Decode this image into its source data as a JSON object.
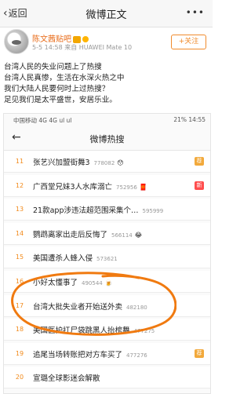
{
  "header": {
    "back_label": "返回",
    "title": "微博正文",
    "more": "•••"
  },
  "author": {
    "name": "陈文茜贴吧",
    "meta": "5-5 14:58 来自 HUAWEI Mate 10",
    "follow_label": "+关注"
  },
  "post_lines": [
    "台湾人民的失业问题上了热搜",
    "台湾人民真惨，生活在水深火热之中",
    "我们大陆人民要何时上过热搜？",
    "足见我们是太平盛世，安居乐业。"
  ],
  "screenshot": {
    "status_left": "中国移动 4G 4G ul ul",
    "status_right": "21% 14:55",
    "nav_back": "←",
    "nav_title": "微博热搜",
    "rows": [
      {
        "rank": "11",
        "title": "张艺兴加盟街舞3",
        "count": "778082",
        "emoji": "😯",
        "tag": "荐",
        "tag_color": "#f2a93b"
      },
      {
        "rank": "12",
        "title": "广西堂兄妹3人水库溺亡",
        "count": "752956",
        "emoji": "🧧",
        "tag": "新",
        "tag_color": "#ff4d4d"
      },
      {
        "rank": "13",
        "title": "21款app涉违法超范围采集个…",
        "count": "595999",
        "emoji": "",
        "tag": "",
        "tag_color": ""
      },
      {
        "rank": "14",
        "title": "鹦鹉离家出走后反悔了",
        "count": "566114",
        "emoji": "😂",
        "tag": "",
        "tag_color": ""
      },
      {
        "rank": "15",
        "title": "美国遭杀人蜂入侵",
        "count": "573621",
        "emoji": "",
        "tag": "",
        "tag_color": ""
      },
      {
        "rank": "16",
        "title": "小好太懂事了",
        "count": "490544",
        "emoji": "🍺",
        "tag": "",
        "tag_color": ""
      },
      {
        "rank": "17",
        "title": "台湾大批失业者开始送外卖",
        "count": "482180",
        "emoji": "",
        "tag": "",
        "tag_color": ""
      },
      {
        "rank": "18",
        "title": "美国医护扛尸袋跳黑人抬棺舞",
        "count": "477275",
        "emoji": "",
        "tag": "",
        "tag_color": ""
      },
      {
        "rank": "19",
        "title": "追尾当场转账把对方车买了",
        "count": "477276",
        "emoji": "",
        "tag": "荐",
        "tag_color": "#f2a93b"
      },
      {
        "rank": "20",
        "title": "宣璐全球影迷会解散",
        "count": "",
        "emoji": "",
        "tag": "",
        "tag_color": ""
      }
    ]
  },
  "colors": {
    "accent": "#f08b2c",
    "rank": "#f28a1a",
    "annotation": "#f07a10"
  }
}
